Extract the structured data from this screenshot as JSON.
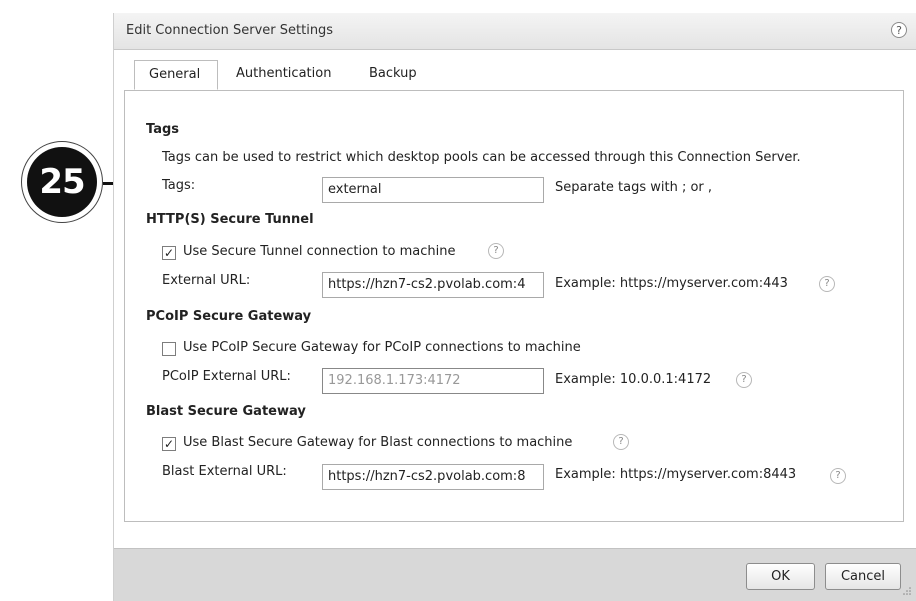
{
  "callout": {
    "number": "25"
  },
  "dialog": {
    "title": "Edit Connection Server Settings",
    "help_glyph": "?",
    "tabs": [
      {
        "label": "General",
        "active": true
      },
      {
        "label": "Authentication",
        "active": false
      },
      {
        "label": "Backup",
        "active": false
      }
    ],
    "tags": {
      "heading": "Tags",
      "description": "Tags can be used to restrict which desktop pools can be accessed through this Connection Server.",
      "label": "Tags:",
      "value": "external",
      "hint": "Separate tags with ; or ,"
    },
    "secure_tunnel": {
      "heading": "HTTP(S) Secure Tunnel",
      "checkbox_label": "Use Secure Tunnel connection to machine",
      "checked": true,
      "url_label": "External URL:",
      "url_value": "https://hzn7-cs2.pvolab.com:4",
      "example": "Example: https://myserver.com:443"
    },
    "pcoip": {
      "heading": "PCoIP Secure Gateway",
      "checkbox_label": "Use PCoIP Secure Gateway for PCoIP connections to machine",
      "checked": false,
      "url_label": "PCoIP External URL:",
      "url_value": "192.168.1.173:4172",
      "example": "Example: 10.0.0.1:4172"
    },
    "blast": {
      "heading": "Blast Secure Gateway",
      "checkbox_label": "Use Blast Secure Gateway for Blast connections to machine",
      "checked": true,
      "url_label": "Blast External URL:",
      "url_value": "https://hzn7-cs2.pvolab.com:8",
      "example": "Example: https://myserver.com:8443"
    },
    "buttons": {
      "ok": "OK",
      "cancel": "Cancel"
    },
    "check_glyph": "✓"
  }
}
